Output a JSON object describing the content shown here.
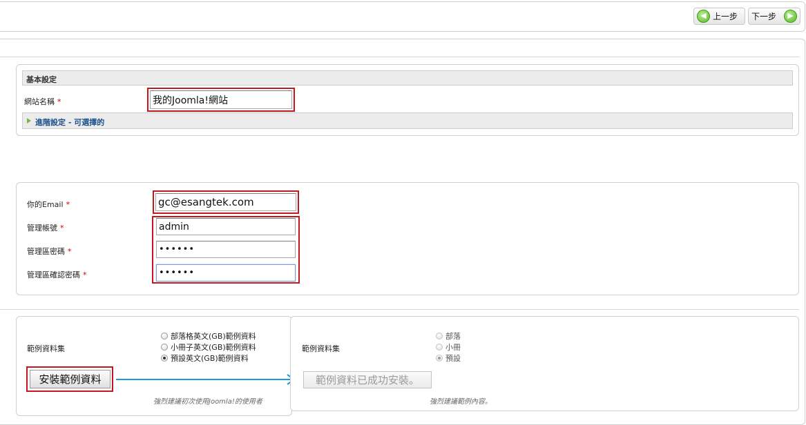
{
  "toolbar": {
    "prev_label": "上一步",
    "next_label": "下一步"
  },
  "site_config": {
    "legend": "基本設定",
    "site_name_label": "網站名稱",
    "site_name_value": "我的Joomla!網站",
    "required_mark": "*",
    "advanced_label": "進階設定 - 可選擇的"
  },
  "admin": {
    "email_label": "你的Email",
    "email_value": "gc@esangtek.com",
    "username_label": "管理帳號",
    "username_value": "admin",
    "password_label": "管理區密碼",
    "password_value": "••••••",
    "confirm_label": "管理區確認密碼",
    "confirm_value": "••••••"
  },
  "sample_left": {
    "label": "範例資料集",
    "options": [
      "部落格英文(GB)範例資料",
      "小冊子英文(GB)範例資料",
      "預設英文(GB)範例資料"
    ],
    "selected_index": 2,
    "install_button": "安裝範例資料",
    "note": "強烈建議初次使用Joomla!的使用者"
  },
  "sample_right": {
    "label": "範例資料集",
    "options": [
      "部落",
      "小冊",
      "預設"
    ],
    "selected_index": 2,
    "installed_button": "範例資料已成功安裝。",
    "note": "強烈建議範例內容。"
  },
  "colors": {
    "highlight_box": "#c4171d",
    "arrow": "#1a9ad6",
    "advanced_link": "#1b4f8a",
    "nav_icon": "#57b82d"
  }
}
